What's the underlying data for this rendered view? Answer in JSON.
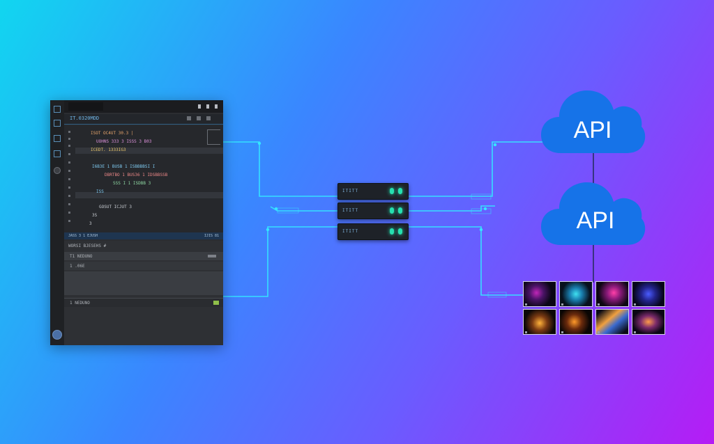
{
  "diagram": {
    "editor": {
      "tab_title": "IT.0320MDD",
      "status_left": "JASS 3 1 EJUSH",
      "status_right": "IJIS 81",
      "panel_header": "WORSI BJESEHS #",
      "panel_row_1": "T1 NEDUNO",
      "panel_row_2": "1 .06E",
      "panel_row_3": "1 NEDUNO",
      "code_lines": [
        "ISOT OC4UT  30.3 |",
        "UOHNS  333 3 ISSS 3 B03",
        "ICEDT.        1333IG3",
        "I6B3E 1 BUSB 1 ISBBBBSI I",
        "DBRTBO 1 BUS36 1 IDSBBSSB",
        "SSS  I 1 ISDBB 3",
        "ISS",
        "GOSUT ICJUT 3",
        "3S",
        "3"
      ]
    },
    "servers": [
      {
        "label": "ITITT"
      },
      {
        "label": "ITITT"
      },
      {
        "label": "ITITT"
      }
    ],
    "clouds": [
      {
        "label": "API"
      },
      {
        "label": "API"
      }
    ],
    "colors": {
      "connector": "#35e6ff",
      "cloud": "#1673e8",
      "led": "#26e0b0"
    },
    "images": {
      "count": 8
    }
  }
}
